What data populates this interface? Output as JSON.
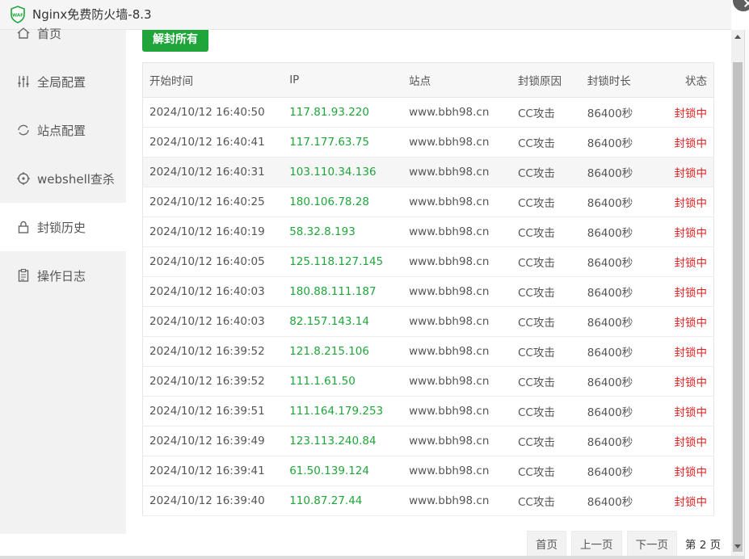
{
  "window": {
    "title": "Nginx免费防火墙-8.3"
  },
  "sidebar": {
    "items": [
      {
        "label": "首页",
        "icon": "home-icon"
      },
      {
        "label": "全局配置",
        "icon": "sliders-icon"
      },
      {
        "label": "站点配置",
        "icon": "refresh-icon"
      },
      {
        "label": "webshell查杀",
        "icon": "target-icon"
      },
      {
        "label": "封锁历史",
        "icon": "lock-icon",
        "active": true
      },
      {
        "label": "操作日志",
        "icon": "clipboard-icon"
      }
    ]
  },
  "toolbar": {
    "unblock_all_label": "解封所有"
  },
  "table": {
    "headers": [
      "开始时间",
      "IP",
      "站点",
      "封锁原因",
      "封锁时长",
      "状态"
    ],
    "rows": [
      [
        "2024/10/12 16:40:50",
        "117.81.93.220",
        "www.bbh98.cn",
        "CC攻击",
        "86400秒",
        "封锁中"
      ],
      [
        "2024/10/12 16:40:41",
        "117.177.63.75",
        "www.bbh98.cn",
        "CC攻击",
        "86400秒",
        "封锁中"
      ],
      [
        "2024/10/12 16:40:31",
        "103.110.34.136",
        "www.bbh98.cn",
        "CC攻击",
        "86400秒",
        "封锁中"
      ],
      [
        "2024/10/12 16:40:25",
        "180.106.78.28",
        "www.bbh98.cn",
        "CC攻击",
        "86400秒",
        "封锁中"
      ],
      [
        "2024/10/12 16:40:19",
        "58.32.8.193",
        "www.bbh98.cn",
        "CC攻击",
        "86400秒",
        "封锁中"
      ],
      [
        "2024/10/12 16:40:05",
        "125.118.127.145",
        "www.bbh98.cn",
        "CC攻击",
        "86400秒",
        "封锁中"
      ],
      [
        "2024/10/12 16:40:03",
        "180.88.111.187",
        "www.bbh98.cn",
        "CC攻击",
        "86400秒",
        "封锁中"
      ],
      [
        "2024/10/12 16:40:03",
        "82.157.143.14",
        "www.bbh98.cn",
        "CC攻击",
        "86400秒",
        "封锁中"
      ],
      [
        "2024/10/12 16:39:52",
        "121.8.215.106",
        "www.bbh98.cn",
        "CC攻击",
        "86400秒",
        "封锁中"
      ],
      [
        "2024/10/12 16:39:52",
        "111.1.61.50",
        "www.bbh98.cn",
        "CC攻击",
        "86400秒",
        "封锁中"
      ],
      [
        "2024/10/12 16:39:51",
        "111.164.179.253",
        "www.bbh98.cn",
        "CC攻击",
        "86400秒",
        "封锁中"
      ],
      [
        "2024/10/12 16:39:49",
        "123.113.240.84",
        "www.bbh98.cn",
        "CC攻击",
        "86400秒",
        "封锁中"
      ],
      [
        "2024/10/12 16:39:41",
        "61.50.139.124",
        "www.bbh98.cn",
        "CC攻击",
        "86400秒",
        "封锁中"
      ],
      [
        "2024/10/12 16:39:40",
        "110.87.27.44",
        "www.bbh98.cn",
        "CC攻击",
        "86400秒",
        "封锁中"
      ]
    ],
    "highlighted_row": 2
  },
  "pager": {
    "first": "首页",
    "prev": "上一页",
    "next": "下一页",
    "current": "第 2 页"
  },
  "colors": {
    "accent": "#20a53a",
    "status_blocked": "#e01f1f"
  }
}
